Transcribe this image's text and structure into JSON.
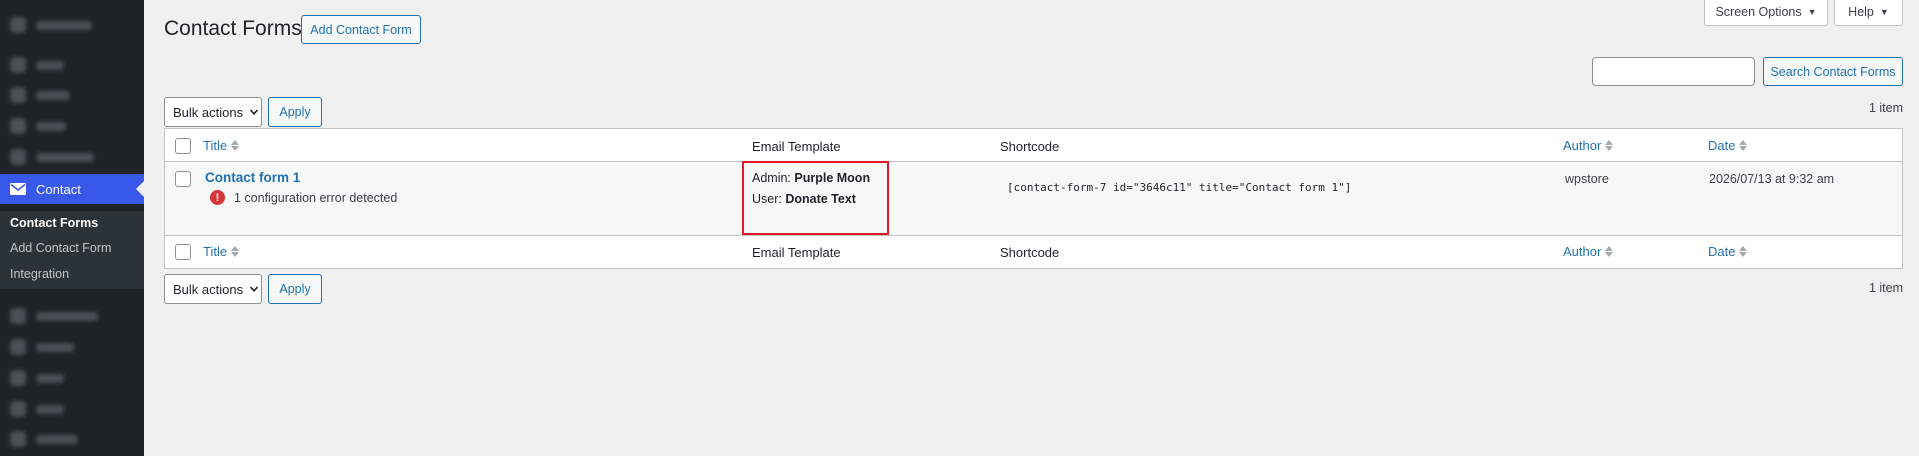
{
  "sidebar": {
    "blurred_top": [
      {
        "w": 56
      },
      {
        "w": 28
      },
      {
        "w": 34
      },
      {
        "w": 30
      },
      {
        "w": 58
      }
    ],
    "current": {
      "label": "Contact"
    },
    "submenu": [
      {
        "label": "Contact Forms",
        "active": true
      },
      {
        "label": "Add Contact Form",
        "active": false
      },
      {
        "label": "Integration",
        "active": false
      }
    ],
    "blurred_bottom": [
      {
        "w": 62
      },
      {
        "w": 38
      },
      {
        "w": 28
      },
      {
        "w": 28
      },
      {
        "w": 42
      }
    ]
  },
  "header": {
    "title": "Contact Forms",
    "add_button": "Add Contact Form",
    "screen_options": "Screen Options",
    "help": "Help",
    "search_button": "Search Contact Forms",
    "search_value": ""
  },
  "bulk": {
    "label": "Bulk actions",
    "apply": "Apply",
    "count": "1 item"
  },
  "table": {
    "columns": {
      "title": "Title",
      "email_template": "Email Template",
      "shortcode": "Shortcode",
      "author": "Author",
      "date": "Date"
    },
    "rows": [
      {
        "title": "Contact form 1",
        "error": "1 configuration error detected",
        "template_admin_label": "Admin: ",
        "template_admin_value": "Purple Moon",
        "template_user_label": "User: ",
        "template_user_value": "Donate Text",
        "shortcode": "[contact-form-7 id=\"3646c11\" title=\"Contact form 1\"]",
        "author": "wpstore",
        "date": "2026/07/13 at 9:32 am"
      }
    ]
  },
  "colors": {
    "accent": "#2271b1",
    "menu_current": "#3858e9",
    "sidebar": "#1d2327",
    "error": "#d63638",
    "highlight": "#e01b24"
  }
}
